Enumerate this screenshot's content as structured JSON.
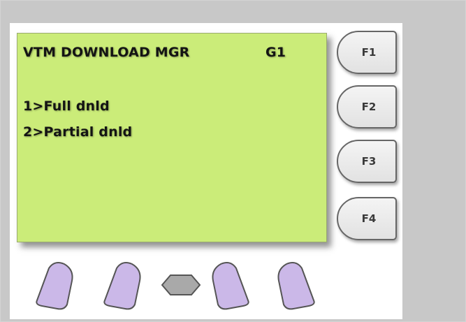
{
  "screen": {
    "title": "VTM DOWNLOAD MGR",
    "group": "G1",
    "menu_items": [
      "1>Full dnld",
      "2>Partial dnld"
    ]
  },
  "function_keys": [
    {
      "label": "F1"
    },
    {
      "label": "F2"
    },
    {
      "label": "F3"
    },
    {
      "label": "F4"
    }
  ],
  "soft_keys": [
    "left-1",
    "left-2",
    "center",
    "right-1",
    "right-2"
  ],
  "colors": {
    "lcd_background": "#cbec79",
    "softkey_fill": "#cbb8e8",
    "center_key_fill": "#a9a9a9",
    "frame_gray": "#c8c8c8"
  }
}
